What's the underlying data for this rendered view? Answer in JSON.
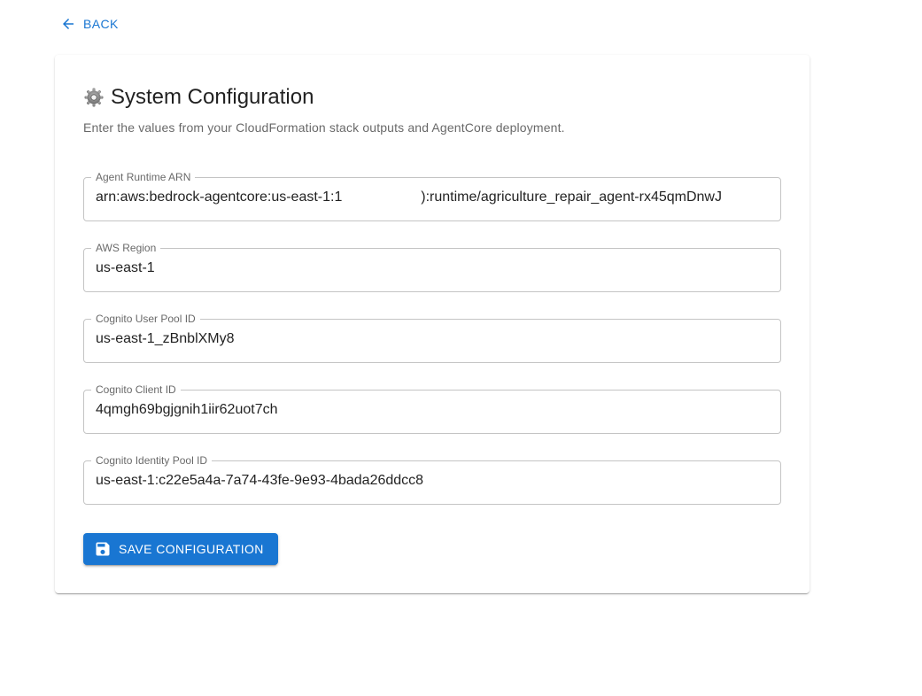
{
  "nav": {
    "back_label": "Back"
  },
  "config": {
    "title": "System Configuration",
    "subtitle": "Enter the values from your CloudFormation stack outputs and AgentCore deployment.",
    "fields": [
      {
        "label": "Agent Runtime ARN",
        "value": "arn:aws:bedrock-agentcore:us-east-1:1                    ):runtime/agriculture_repair_agent-rx45qmDnwJ"
      },
      {
        "label": "AWS Region",
        "value": "us-east-1"
      },
      {
        "label": "Cognito User Pool ID",
        "value": "us-east-1_zBnblXMy8"
      },
      {
        "label": "Cognito Client ID",
        "value": "4qmgh69bgjgnih1iir62uot7ch"
      },
      {
        "label": "Cognito Identity Pool ID",
        "value": "us-east-1:c22e5a4a-7a74-43fe-9e93-4bada26ddcc8"
      }
    ],
    "save_label": "Save Configuration"
  },
  "icons": {
    "back": "arrow-left-icon",
    "title": "gear-icon",
    "save": "floppy-disk-icon"
  },
  "colors": {
    "primary": "#1976d2",
    "text_secondary": "#666666",
    "border": "#c4c4c4"
  }
}
